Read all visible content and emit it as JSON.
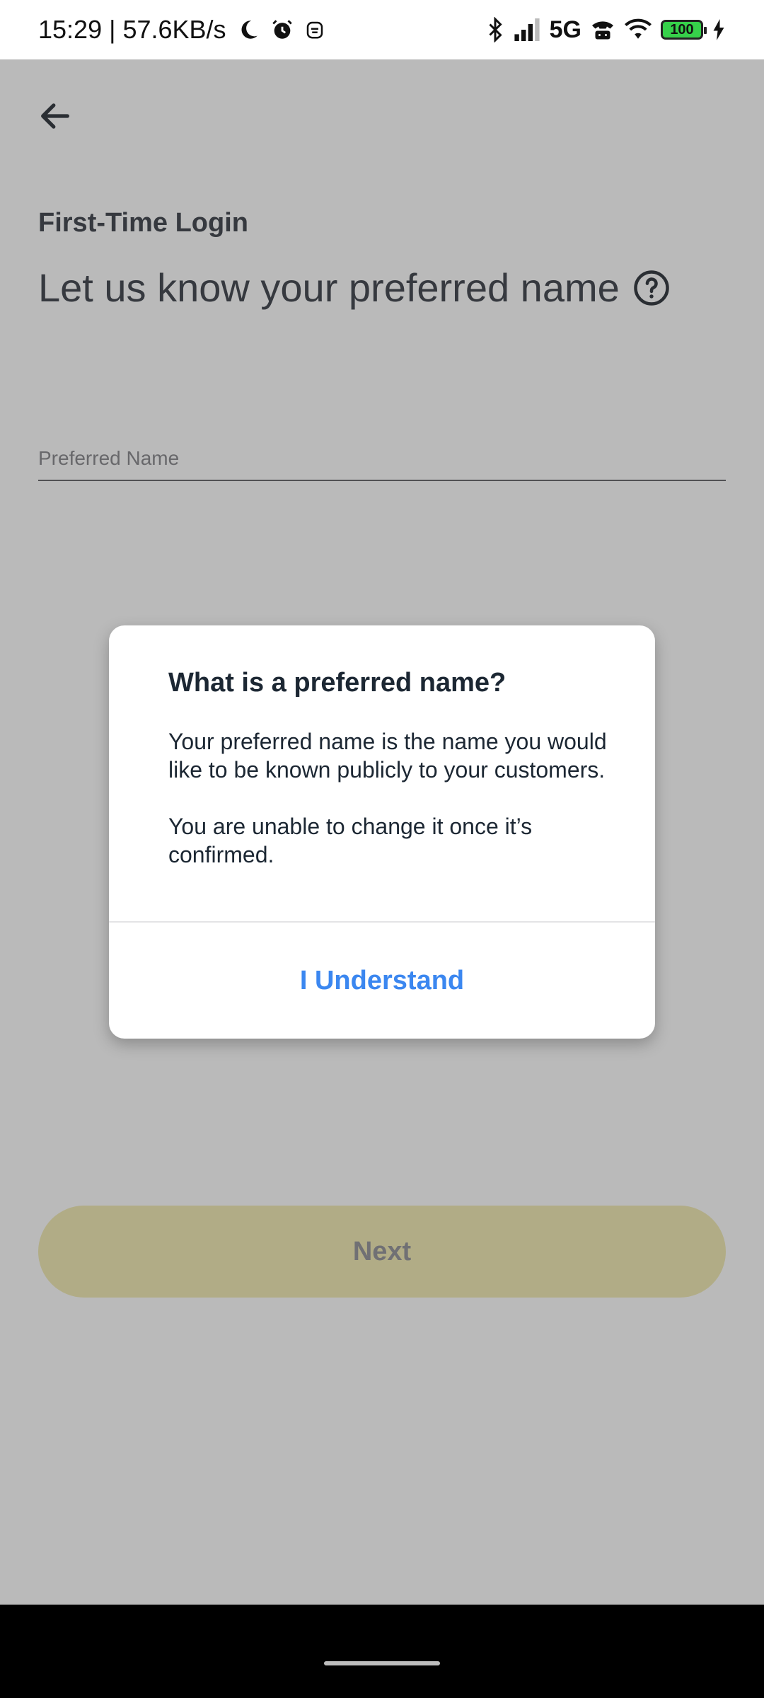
{
  "status_bar": {
    "time_speed": "15:29 | 57.6KB/s",
    "network": "5G",
    "battery_level": "100",
    "icons": [
      "moon-icon",
      "alarm-icon",
      "notification-icon",
      "bluetooth-icon",
      "signal-icon",
      "hd-call-icon",
      "wifi-icon",
      "battery-icon",
      "charging-icon"
    ]
  },
  "header": {
    "back_icon": "back-arrow-icon"
  },
  "page": {
    "subtitle": "First-Time Login",
    "heading": "Let us know your preferred name",
    "help_icon": "help-circle-icon",
    "preferred_name_placeholder": "Preferred Name",
    "preferred_name_value": "",
    "next_label": "Next"
  },
  "dialog": {
    "title": "What is a preferred name?",
    "paragraph1": "Your preferred name is the name you would like to be known publicly to your customers.",
    "paragraph2": "You are unable to change it once it’s confirmed.",
    "action_label": "I Understand"
  },
  "colors": {
    "accent": "#3b87f0",
    "next_button_bg": "#f3ecb8",
    "text_dark": "#1c2733",
    "scrim": "rgba(0,0,0,0.27)"
  }
}
